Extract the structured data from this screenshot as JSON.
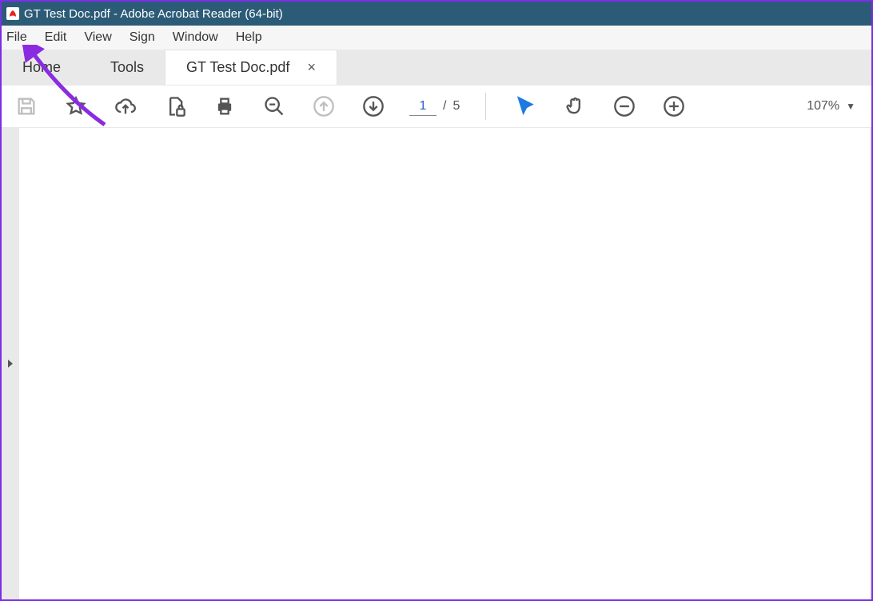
{
  "titlebar": {
    "title": "GT Test Doc.pdf - Adobe Acrobat Reader (64-bit)"
  },
  "menubar": {
    "file": "File",
    "edit": "Edit",
    "view": "View",
    "sign": "Sign",
    "window": "Window",
    "help": "Help"
  },
  "tabs": {
    "home": "Home",
    "tools": "Tools",
    "doc": "GT Test Doc.pdf"
  },
  "toolbar": {
    "page_current": "1",
    "page_sep": "/",
    "page_total": "5",
    "zoom": "107%"
  }
}
